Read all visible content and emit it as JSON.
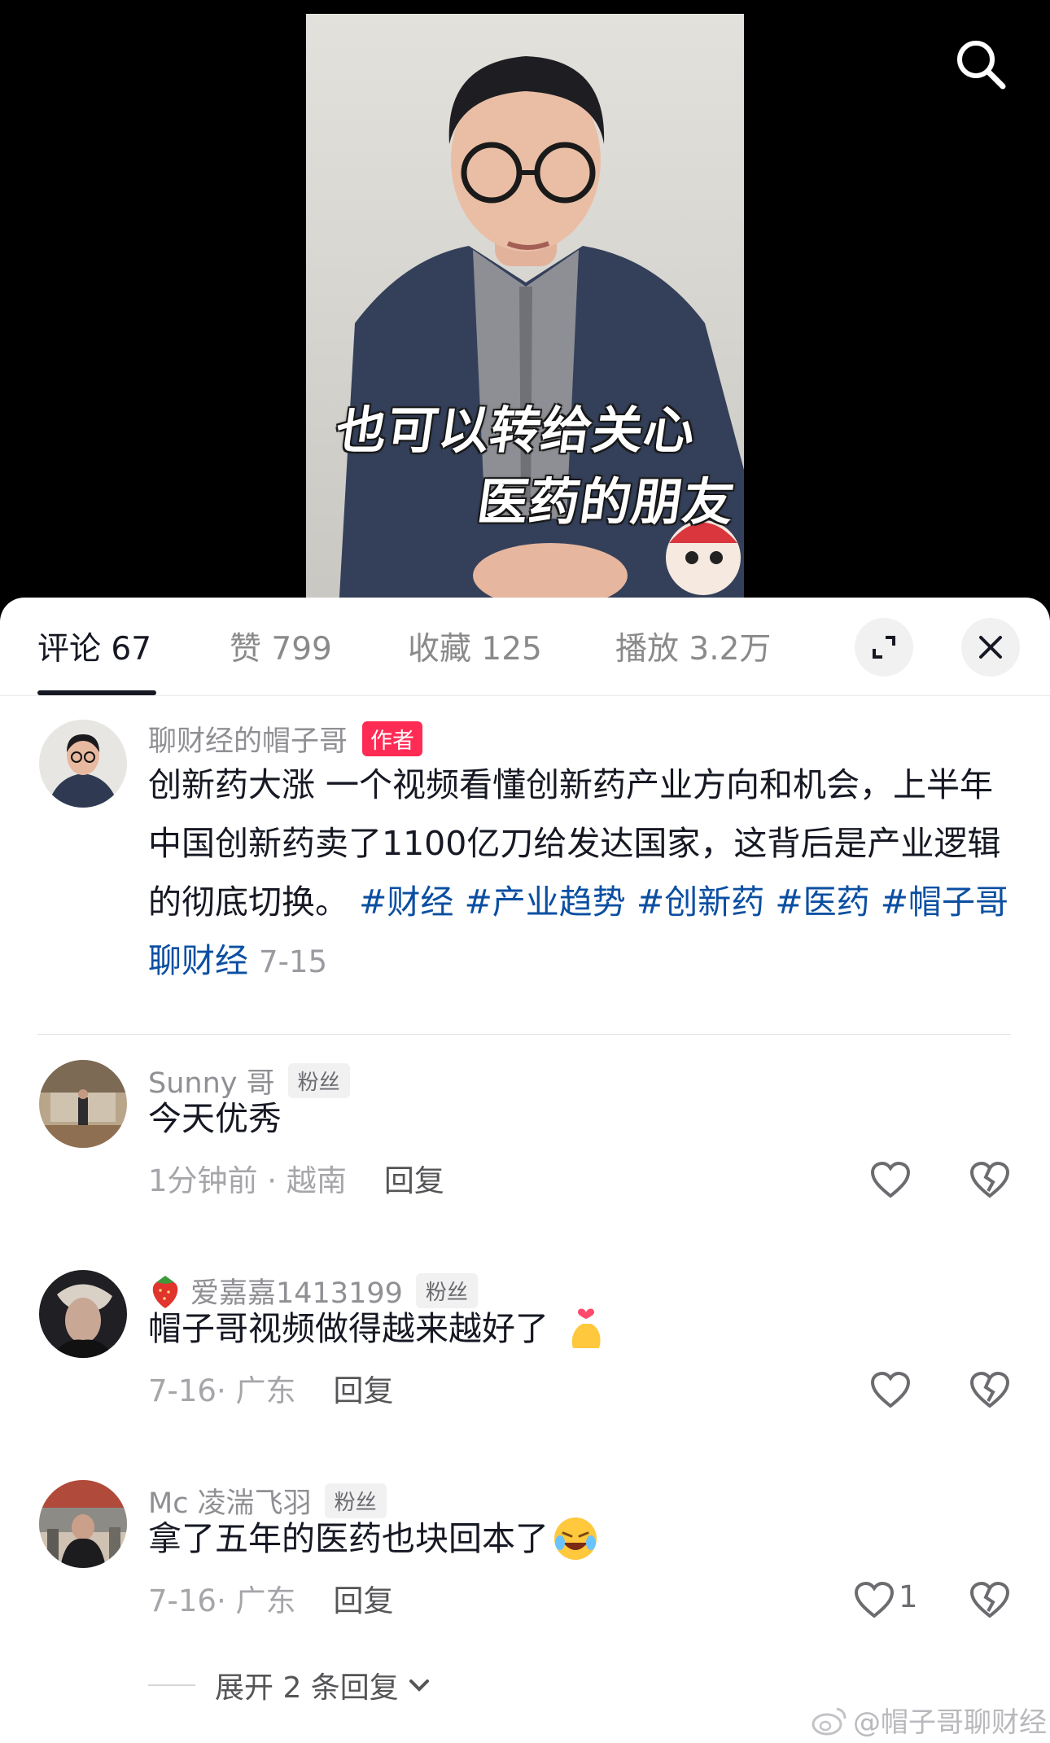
{
  "video": {
    "caption_line1": "也可以转给关心",
    "caption_line2": "医药的朋友"
  },
  "tabs": {
    "comments": "评论 67",
    "likes": "赞 799",
    "favorites": "收藏 125",
    "plays": "播放 3.2万"
  },
  "post": {
    "author": "聊财经的帽子哥",
    "author_badge": "作者",
    "text": "创新药大涨 一个视频看懂创新药产业方向和机会，上半年中国创新药卖了1100亿刀给发达国家，这背后是产业逻辑的彻底切换。",
    "hashtags": [
      "#财经",
      "#产业趋势",
      "#创新药",
      "#医药",
      "#帽子哥聊财经"
    ],
    "date": "7-15"
  },
  "comments": [
    {
      "username": "Sunny 哥",
      "badge": "粉丝",
      "text": "今天优秀",
      "meta": "1分钟前 · 越南",
      "reply": "回复",
      "likes": ""
    },
    {
      "username": "爱嘉嘉1413199",
      "badge": "粉丝",
      "text": "帽子哥视频做得越来越好了",
      "meta": "7-16· 广东",
      "reply": "回复",
      "likes": ""
    },
    {
      "username": "Mc 凌湍飞羽",
      "badge": "粉丝",
      "text": "拿了五年的医药也块回本了",
      "meta": "7-16· 广东",
      "reply": "回复",
      "likes": "1"
    }
  ],
  "expand_replies": "展开 2 条回复",
  "watermark": "@帽子哥聊财经",
  "colors": {
    "accent": "#fe2c55",
    "hashtag": "#0b4fa2",
    "text": "#161823"
  }
}
